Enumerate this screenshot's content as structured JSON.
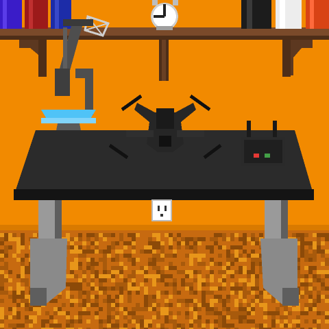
{
  "scene": {
    "title": "",
    "colors": {
      "wall": "#f28a00",
      "wall_stripe": "#e37e00",
      "floor": "#c76a10",
      "floor_dark": "#8c4a08",
      "floor_light": "#e8961a",
      "shelf": "#7a4a2a",
      "shelf_dark": "#4e2e18",
      "desk_top": "#2b2b2b",
      "desk_edge": "#141414",
      "desk_leg": "#9a9a9a",
      "desk_leg_dark": "#5e5e5e",
      "lamp_grey": "#4e4e4e",
      "lamp_screen": "#4fc3f7",
      "drone_body": "#222222",
      "remote_led_red": "#e53935",
      "remote_led_green": "#43a047"
    },
    "books": [
      {
        "color": "#3a1cc8"
      },
      {
        "color": "#9c1a1a"
      },
      {
        "color": "#1c2ca8"
      },
      {
        "color": "#1c1c1c"
      },
      {
        "color": "#ededed"
      },
      {
        "color": "#d84315"
      }
    ],
    "clock": {
      "hour_hand_deg": 270,
      "minute_hand_deg": 0
    },
    "icons": [
      "clock-icon",
      "drone-icon",
      "remote-controller-icon",
      "power-outlet-icon",
      "desk-lamp-icon",
      "basketball-hoop-icon"
    ]
  }
}
